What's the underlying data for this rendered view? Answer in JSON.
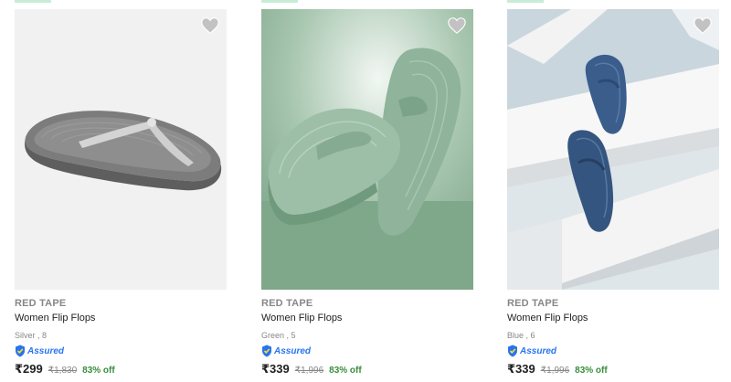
{
  "colors": {
    "brand_gray": "#878787",
    "title": "#212121",
    "assured_blue": "#2874f0",
    "discount_green": "#388e3c",
    "wishlist_gray": "#c2c2c2"
  },
  "products": [
    {
      "brand": "RED TAPE",
      "title": "Women Flip Flops",
      "variant": "Silver , 8",
      "assured": "Assured",
      "price": "₹299",
      "mrp": "₹1,830",
      "discount": "83% off",
      "wishlist_icon": "heart-icon"
    },
    {
      "brand": "RED TAPE",
      "title": "Women Flip Flops",
      "variant": "Green , 5",
      "assured": "Assured",
      "price": "₹339",
      "mrp": "₹1,996",
      "discount": "83% off",
      "wishlist_icon": "heart-icon"
    },
    {
      "brand": "RED TAPE",
      "title": "Women Flip Flops",
      "variant": "Blue , 6",
      "assured": "Assured",
      "price": "₹339",
      "mrp": "₹1,996",
      "discount": "83% off",
      "wishlist_icon": "heart-icon"
    }
  ]
}
